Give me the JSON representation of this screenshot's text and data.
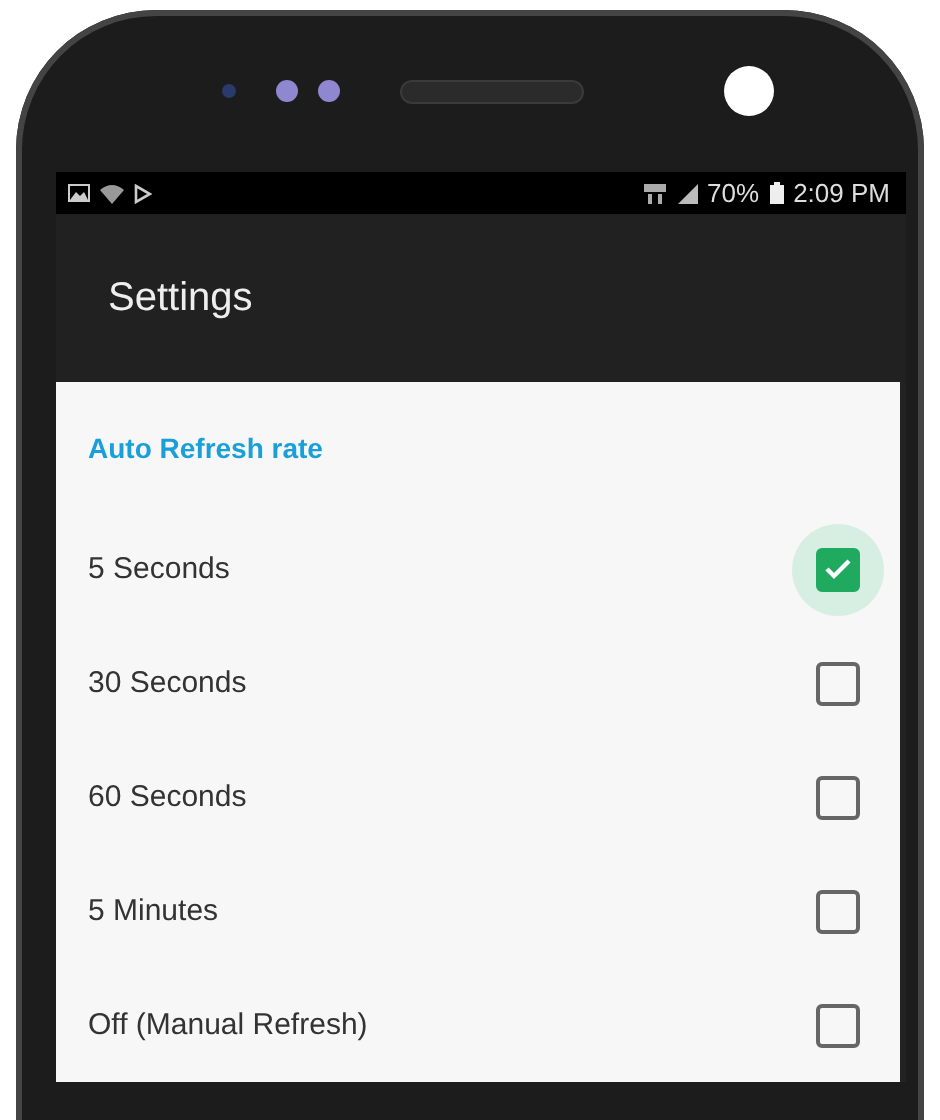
{
  "status_bar": {
    "battery": "70%",
    "time": "2:09 PM"
  },
  "app_bar": {
    "title": "Settings"
  },
  "section": {
    "title": "Auto Refresh rate"
  },
  "options": [
    {
      "label": "5 Seconds",
      "checked": true
    },
    {
      "label": "30 Seconds",
      "checked": false
    },
    {
      "label": "60 Seconds",
      "checked": false
    },
    {
      "label": "5 Minutes",
      "checked": false
    },
    {
      "label": "Off (Manual Refresh)",
      "checked": false
    }
  ]
}
